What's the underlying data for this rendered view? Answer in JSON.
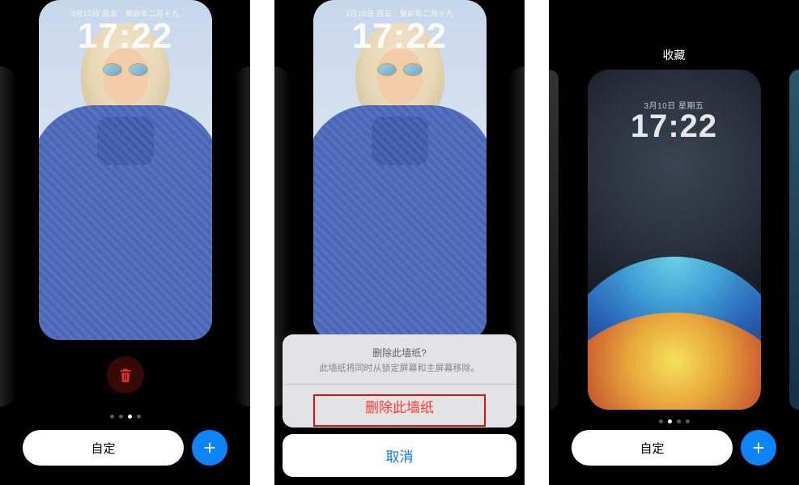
{
  "lockscreen": {
    "date": "3月10日 周五 · 癸卯年二月十九",
    "time": "17:22"
  },
  "panel1": {
    "page_total": 4,
    "page_active": 3
  },
  "panel3": {
    "collection_title": "收藏",
    "date": "3月10日 星期五",
    "time": "17:22",
    "page_total": 4,
    "page_active": 2
  },
  "buttons": {
    "customize": "自定",
    "add": "+"
  },
  "sheet": {
    "title": "删除此墙纸?",
    "subtitle": "此墙纸将同时从锁定屏幕和主屏幕移除。",
    "destroy": "删除此墙纸",
    "cancel": "取消"
  },
  "icons": {
    "trash": "trash"
  }
}
